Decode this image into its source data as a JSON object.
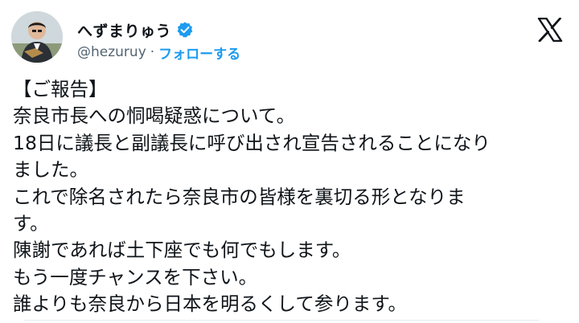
{
  "author": {
    "display_name": "へずまりゅう",
    "handle": "@hezuruy",
    "separator": "·",
    "follow_label": "フォローする",
    "verified_color": "#1d9bf0",
    "avatar_icon": "person-photo",
    "badge_icon": "verified-badge"
  },
  "platform": {
    "logo_icon": "x-logo"
  },
  "tweet": {
    "lines": [
      "【ご報告】",
      "奈良市長への恫喝疑惑について。",
      "18日に議長と副議長に呼び出され宣告されることになり",
      "ました。",
      "これで除名されたら奈良市の皆様を裏切る形となりま",
      "す。",
      "陳謝であれば土下座でも何でもします。",
      "もう一度チャンスを下さい。",
      "誰よりも奈良から日本を明るくして参ります。"
    ]
  },
  "colors": {
    "text": "#0f1419",
    "secondary": "#536471",
    "accent": "#1d9bf0"
  }
}
